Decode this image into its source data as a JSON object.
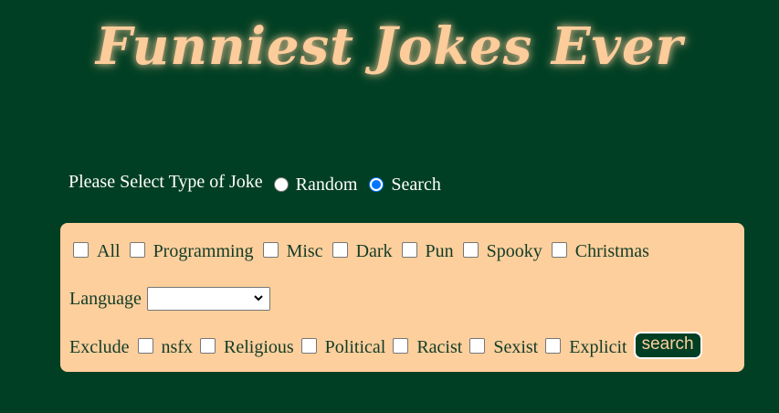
{
  "header": {
    "title": "Funniest Jokes Ever"
  },
  "joke_type": {
    "label": "Please Select Type of Joke",
    "options": [
      {
        "label": "Random",
        "selected": false
      },
      {
        "label": "Search",
        "selected": true
      }
    ]
  },
  "categories": {
    "options": [
      {
        "label": "All",
        "checked": false
      },
      {
        "label": "Programming",
        "checked": false
      },
      {
        "label": "Misc",
        "checked": false
      },
      {
        "label": "Dark",
        "checked": false
      },
      {
        "label": "Pun",
        "checked": false
      },
      {
        "label": "Spooky",
        "checked": false
      },
      {
        "label": "Christmas",
        "checked": false
      }
    ]
  },
  "language": {
    "label": "Language",
    "selected": ""
  },
  "exclude": {
    "label": "Exclude",
    "options": [
      {
        "label": "nsfx",
        "checked": false
      },
      {
        "label": "Religious",
        "checked": false
      },
      {
        "label": "Political",
        "checked": false
      },
      {
        "label": "Racist",
        "checked": false
      },
      {
        "label": "Sexist",
        "checked": false
      },
      {
        "label": "Explicit",
        "checked": false
      }
    ]
  },
  "search_button": {
    "label": "search"
  },
  "colors": {
    "background": "#013f24",
    "title": "#fdcc9b",
    "panel": "#fdcf9c",
    "radio_accent": "#0075ff"
  }
}
